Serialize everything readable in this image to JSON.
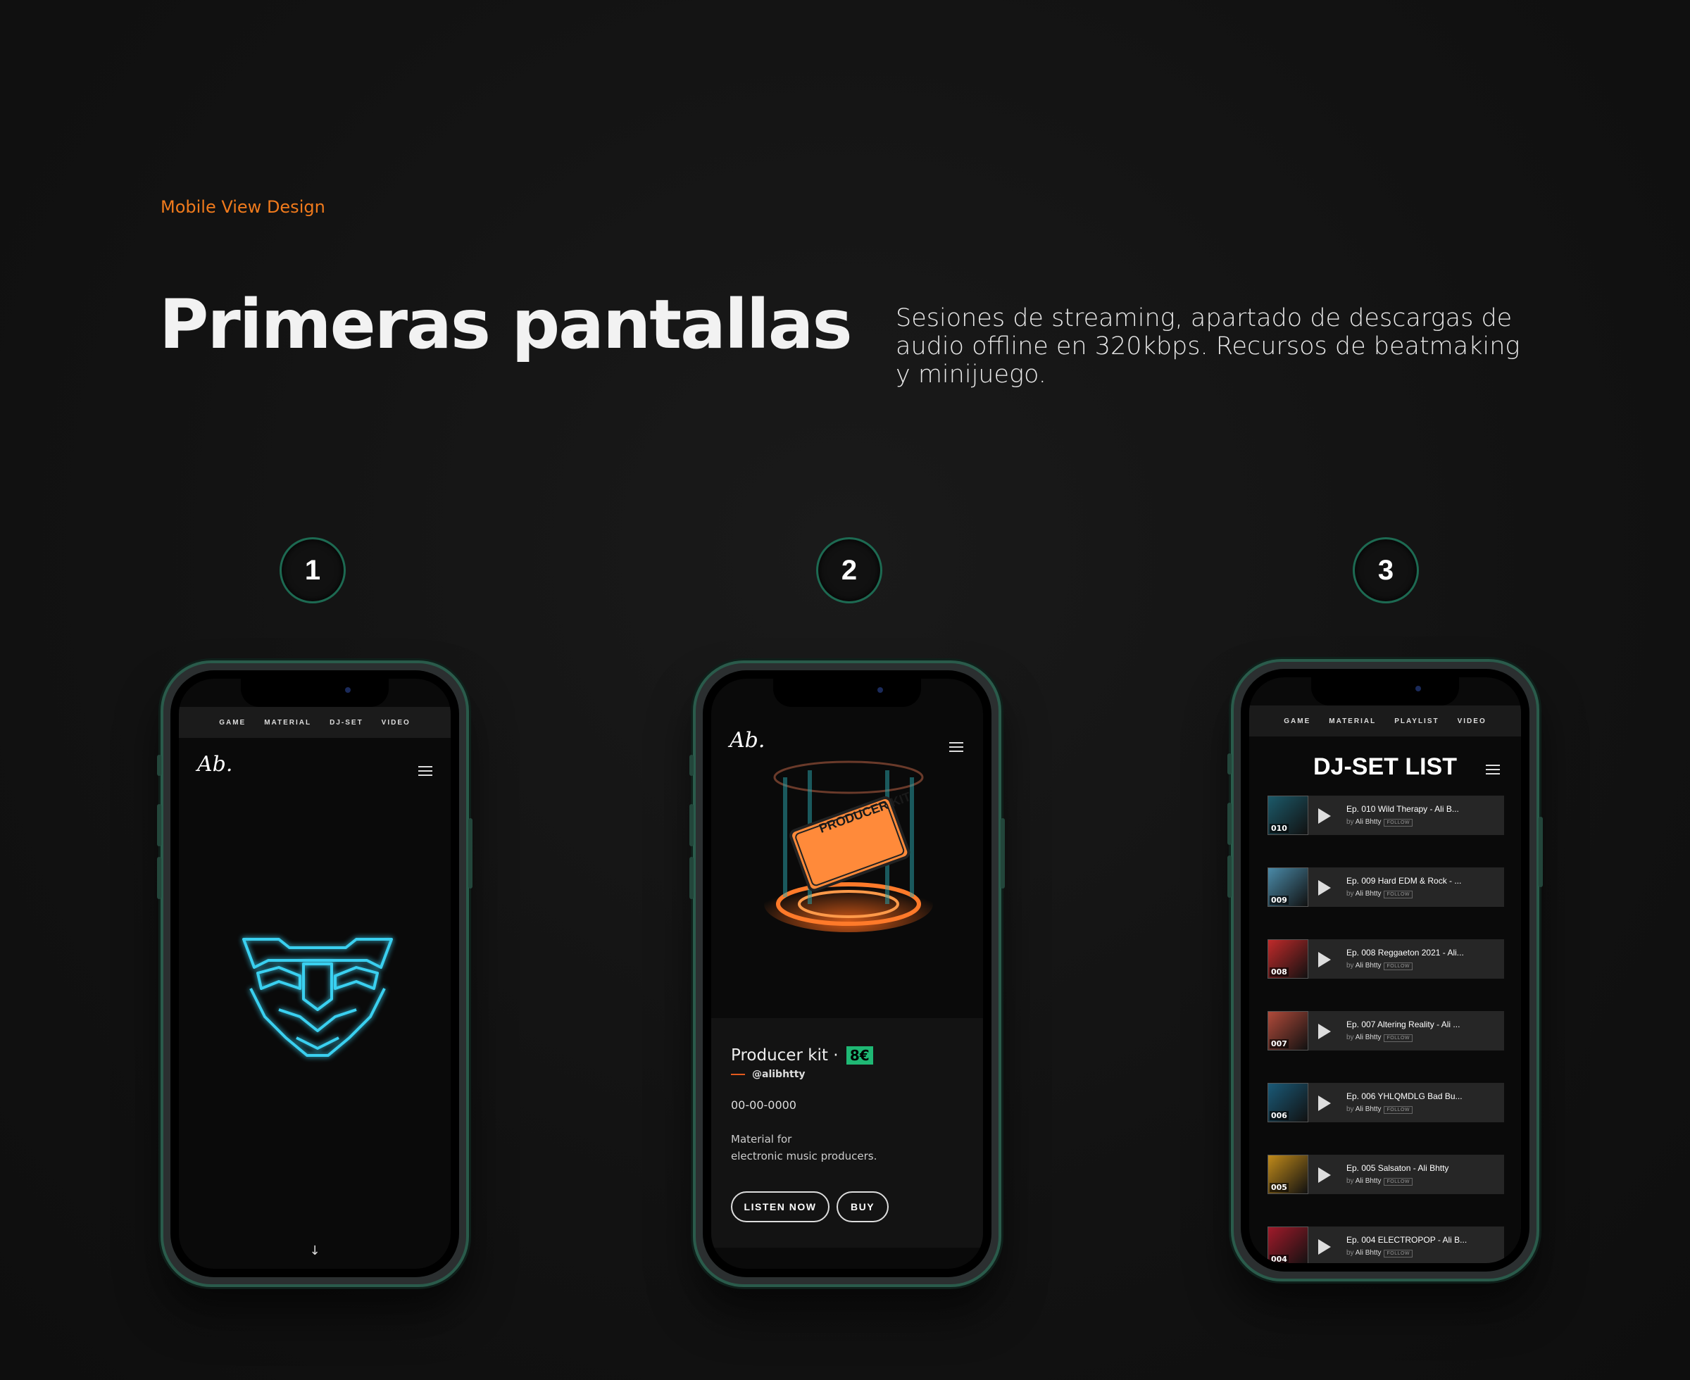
{
  "header": {
    "eyebrow": "Mobile View Design",
    "title": "Primeras pantallas",
    "description": "Sesiones  de streaming,  apartado de  descargas de audio offline en 320kbps. Recursos de beatmaking y minijuego."
  },
  "steps": [
    "1",
    "2",
    "3"
  ],
  "screen1": {
    "nav": [
      "GAME",
      "MATERIAL",
      "DJ-SET",
      "VIDEO"
    ],
    "logo": "Ab.",
    "scroll_arrow": "↓"
  },
  "screen2": {
    "logo": "Ab.",
    "product_title": "Producer kit ·",
    "price": "8€",
    "handle": "@alibhtty",
    "date": "00-00-0000",
    "desc_line1": "Material for",
    "desc_line2": "electronic music producers.",
    "listen_label": "LISTEN NOW",
    "buy_label": "BUY",
    "kit_label": "PRODUCER KIT"
  },
  "screen3": {
    "nav": [
      "GAME",
      "MATERIAL",
      "PLAYLIST",
      "VIDEO"
    ],
    "title": "DJ-SET LIST",
    "items": [
      {
        "num": "010",
        "title": "Ep. 010 Wild Therapy - Ali B...",
        "by": "by",
        "artist": "Ali Bhtty",
        "follow": "FOLLOW",
        "color": "#1c5a6a"
      },
      {
        "num": "009",
        "title": "Ep. 009 Hard EDM & Rock - ...",
        "by": "by",
        "artist": "Ali Bhtty",
        "follow": "FOLLOW",
        "color": "#4a8aa8"
      },
      {
        "num": "008",
        "title": "Ep. 008 Reggaeton 2021 - Ali...",
        "by": "by",
        "artist": "Ali Bhtty",
        "follow": "FOLLOW",
        "color": "#c02a2a"
      },
      {
        "num": "007",
        "title": "Ep. 007 Altering Reality - Ali ...",
        "by": "by",
        "artist": "Ali Bhtty",
        "follow": "FOLLOW",
        "color": "#b04a3a"
      },
      {
        "num": "006",
        "title": "Ep. 006 YHLQMDLG Bad Bu...",
        "by": "by",
        "artist": "Ali Bhtty",
        "follow": "FOLLOW",
        "color": "#1a5a78"
      },
      {
        "num": "005",
        "title": "Ep. 005 Salsaton - Ali Bhtty",
        "by": "by",
        "artist": "Ali Bhtty",
        "follow": "FOLLOW",
        "color": "#c08a1a"
      },
      {
        "num": "004",
        "title": "Ep. 004 ELECTROPOP - Ali B...",
        "by": "by",
        "artist": "Ali Bhtty",
        "follow": "FOLLOW",
        "color": "#a01a2a"
      }
    ]
  },
  "colors": {
    "accent": "#f07a1c",
    "price_green": "#1fb874",
    "frame_green": "#2a5b4b",
    "panther_cyan": "#3ad0f0"
  }
}
